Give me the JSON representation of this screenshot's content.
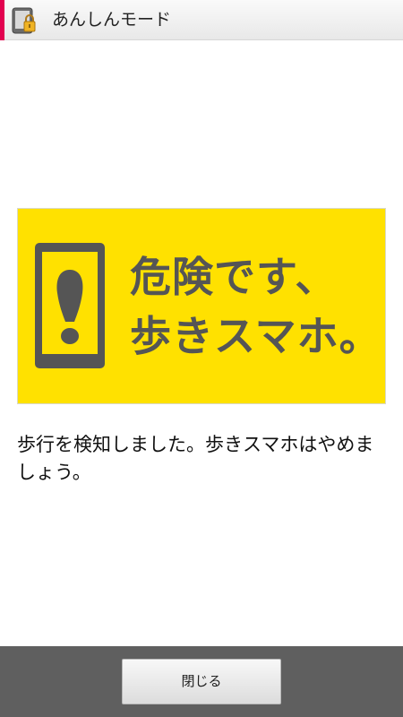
{
  "titlebar": {
    "title": "あんしんモード",
    "icon": "phone-lock-icon",
    "accent_color": "#e2004f"
  },
  "banner": {
    "line1": "危険です、",
    "line2": "歩きスマホ。",
    "icon": "phone-footprint-icon",
    "background_color": "#ffe100",
    "text_color": "#555555"
  },
  "message": {
    "text": "歩行を検知しました。歩きスマホはやめましょう。"
  },
  "footer": {
    "close_label": "閉じる"
  }
}
